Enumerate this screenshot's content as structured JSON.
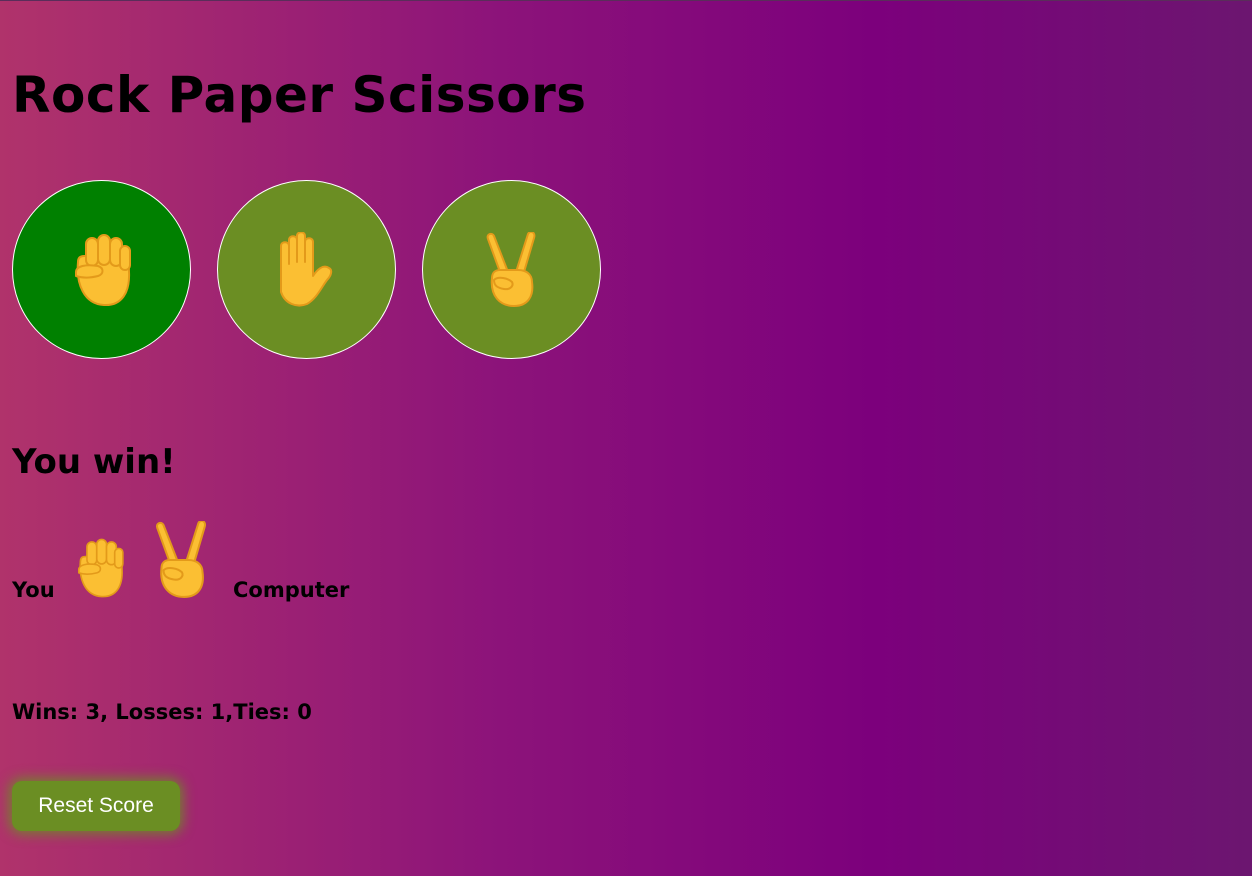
{
  "header": {
    "title": "Rock Paper Scissors"
  },
  "choices": [
    {
      "name": "rock",
      "icon": "raised-fist-icon",
      "selected": true
    },
    {
      "name": "paper",
      "icon": "raised-hand-icon",
      "selected": false
    },
    {
      "name": "scissors",
      "icon": "victory-hand-icon",
      "selected": false
    }
  ],
  "result": {
    "text": "You win!"
  },
  "moves": {
    "you_label": "You",
    "computer_label": "Computer",
    "player_move_icon": "raised-fist-icon",
    "computer_move_icon": "victory-hand-icon"
  },
  "score": {
    "text": "Wins: 3, Losses: 1,Ties: 0",
    "wins": 3,
    "losses": 1,
    "ties": 0
  },
  "controls": {
    "reset_label": "Reset Score"
  },
  "colors": {
    "button_green": "#6b8e23",
    "selected_green": "#008000",
    "hand_yellow": "#fbbf33",
    "hand_line": "#e39a1a",
    "background_start": "#b0336b",
    "background_mid": "#7c007c"
  }
}
